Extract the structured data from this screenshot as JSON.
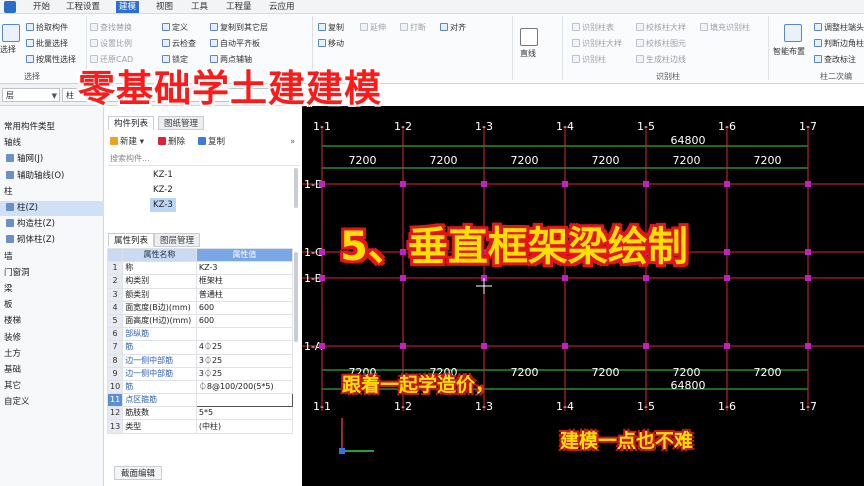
{
  "menu": {
    "items": [
      "开始",
      "工程设置",
      "建模",
      "视图",
      "工具",
      "工程量",
      "云应用"
    ],
    "active_index": 2
  },
  "ribbon": {
    "select_group": {
      "big_button": "选择",
      "items": [
        "拾取构件",
        "批量选择",
        "按属性选择"
      ],
      "label": "选择"
    },
    "clipboard_items": [
      "查找替换",
      "设置比例",
      "还原CAD"
    ],
    "define_items": [
      "定义",
      "云检查",
      "锁定"
    ],
    "layer_items": [
      "复制到其它层",
      "自动平齐板",
      "两点辅轴"
    ],
    "edit_items": [
      "复制",
      "移动",
      "延伸",
      "打断",
      "对齐"
    ],
    "draw_items": [
      "直线"
    ],
    "recognize_items": [
      "识别柱表",
      "识别柱大样",
      "识别柱",
      "校核柱大样",
      "校核柱图元",
      "生成柱边线",
      "填充识别柱"
    ],
    "recognize_label": "识别柱",
    "smart_items": [
      "智能布置"
    ],
    "column_items": [
      "调整柱端头",
      "判断边角柱",
      "查改标注"
    ],
    "column_label": "柱二次编"
  },
  "selector": {
    "floor_value": "层",
    "type_value": "柱"
  },
  "left_nav": {
    "items": [
      {
        "label": "常用构件类型",
        "type": "section"
      },
      {
        "label": "轴线",
        "type": "section"
      },
      {
        "label": "轴网(J)",
        "type": "item"
      },
      {
        "label": "辅助轴线(O)",
        "type": "item"
      },
      {
        "label": "柱",
        "type": "section"
      },
      {
        "label": "柱(Z)",
        "type": "item",
        "selected": true
      },
      {
        "label": "构造柱(Z)",
        "type": "item"
      },
      {
        "label": "砌体柱(Z)",
        "type": "item"
      },
      {
        "label": "墙",
        "type": "section"
      },
      {
        "label": "门窗洞",
        "type": "section"
      },
      {
        "label": "梁",
        "type": "section"
      },
      {
        "label": "板",
        "type": "section"
      },
      {
        "label": "楼梯",
        "type": "section"
      },
      {
        "label": "装修",
        "type": "section"
      },
      {
        "label": "土方",
        "type": "section"
      },
      {
        "label": "基础",
        "type": "section"
      },
      {
        "label": "其它",
        "type": "section"
      },
      {
        "label": "自定义",
        "type": "section"
      }
    ]
  },
  "component_panel": {
    "tabs": [
      "构件列表",
      "图纸管理"
    ],
    "toolbar": [
      "新建",
      "删除",
      "复制"
    ],
    "search_placeholder": "搜索构件...",
    "components": [
      "KZ-1",
      "KZ-2",
      "KZ-3"
    ],
    "selected_component": "KZ-3"
  },
  "properties": {
    "tabs": [
      "属性列表",
      "图层管理"
    ],
    "header": [
      "属性名称",
      "属性值"
    ],
    "rows": [
      {
        "n": "1",
        "k": "称",
        "v": "KZ-3"
      },
      {
        "n": "2",
        "k": "构类别",
        "v": "框架柱"
      },
      {
        "n": "3",
        "k": "额类别",
        "v": "普通柱"
      },
      {
        "n": "4",
        "k": "面宽度(B边)(mm)",
        "v": "600"
      },
      {
        "n": "5",
        "k": "面高度(H边)(mm)",
        "v": "600"
      },
      {
        "n": "6",
        "k": "部纵筋",
        "v": ""
      },
      {
        "n": "7",
        "k": "筋",
        "v": "4⏀25"
      },
      {
        "n": "8",
        "k": "边一侧中部筋",
        "v": "3⏀25"
      },
      {
        "n": "9",
        "k": "边一侧中部筋",
        "v": "3⏀25"
      },
      {
        "n": "10",
        "k": "筋",
        "v": "⏀8@100/200(5*5)"
      },
      {
        "n": "11",
        "k": "点区箍筋",
        "v": ""
      },
      {
        "n": "12",
        "k": "筋肢数",
        "v": "5*5"
      },
      {
        "n": "13",
        "k": "类型",
        "v": "(中柱)"
      }
    ],
    "bottom_tab": "截面编辑"
  },
  "drawing": {
    "axes_x": [
      "1-1",
      "1-2",
      "1-3",
      "1-4",
      "1-5",
      "1-6",
      "1-7"
    ],
    "axes_y": [
      "1-D",
      "1-C",
      "1-B",
      "1-A"
    ],
    "spans": [
      "7200",
      "7200",
      "7200",
      "7200",
      "7200",
      "7200"
    ],
    "total": "64800",
    "colors": {
      "axis": "#e0243a",
      "dim": "#2fd34a",
      "column": "#c020c8",
      "text": "#ffffff"
    }
  },
  "overlays": {
    "title": "零基础学土建建模",
    "subtitle": "5、垂直框架梁绘制",
    "promo_line1": "跟着一起学造价，",
    "promo_line2": "建模一点也不难"
  }
}
